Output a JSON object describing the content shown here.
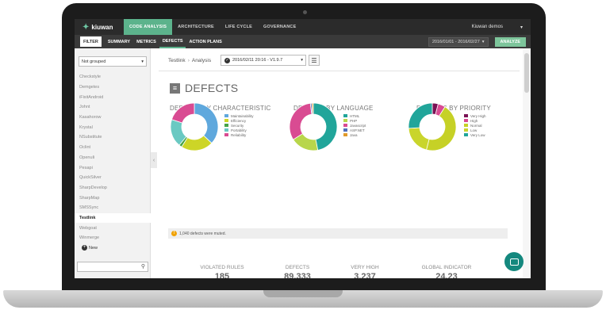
{
  "app": {
    "brand": "kiuwan",
    "nav_tabs": [
      "CODE ANALYSIS",
      "ARCHITECTURE",
      "LIFE CYCLE",
      "GOVERNANCE"
    ],
    "user": "Kiuwan demos"
  },
  "subnav": {
    "filter": "FILTER",
    "tabs": [
      "SUMMARY",
      "METRICS",
      "DEFECTS",
      "ACTION PLANS"
    ],
    "date_range": "2016/01/01 - 2016/02/27",
    "analyze": "ANALYZE"
  },
  "sidebar": {
    "group_select": "Not grouped",
    "projects": [
      "Checkstyle",
      "Demgetes",
      "iFixitAndroid",
      "Johnt",
      "Kasahorow",
      "Krystal",
      "NSubstitute",
      "Oclint",
      "OpenuIi",
      "Pesapi",
      "QuickSilver",
      "SharpDevelop",
      "SharpMap",
      "SMSSync",
      "Testlink",
      "Webgoat",
      "Winmerge"
    ],
    "active_project": "Testlink",
    "new_label": "New"
  },
  "main": {
    "breadcrumb": [
      "Testlink",
      "Analysis"
    ],
    "version": "2016/02/11 20:16 - V1.9.7",
    "title": "DEFECTS",
    "notice": "1,040 defects were muted."
  },
  "charts": {
    "characteristic_title": "DEFECTS BY CHARACTERISTIC",
    "language_title": "DEFECTS BY LANGUAGE",
    "priority_title": "DEFECTS BY PRIORITY"
  },
  "chart_data": [
    {
      "type": "pie",
      "title": "DEFECTS BY CHARACTERISTIC",
      "categories": [
        "Maintainability",
        "Efficiency",
        "Security",
        "Portability",
        "Reliability"
      ],
      "values": [
        37,
        22,
        2,
        19,
        20
      ],
      "colors": [
        "#5fa8dd",
        "#cdd527",
        "#47a447",
        "#6ac9c2",
        "#d94b92"
      ]
    },
    {
      "type": "pie",
      "title": "DEFECTS BY LANGUAGE",
      "categories": [
        "HTML",
        "PHP",
        "Javascript",
        "ASP.NET",
        "Java"
      ],
      "values": [
        47,
        19,
        32,
        1,
        1
      ],
      "colors": [
        "#21a59a",
        "#b8d64b",
        "#d94b92",
        "#4f6fbd",
        "#e09a2b"
      ]
    },
    {
      "type": "pie",
      "title": "DEFECTS BY PRIORITY",
      "categories": [
        "Very High",
        "High",
        "Normal",
        "Low",
        "Very Low"
      ],
      "values": [
        4,
        5,
        45,
        20,
        26
      ],
      "colors": [
        "#7a1254",
        "#d94b92",
        "#c6d126",
        "#c9d52c",
        "#21a59a"
      ]
    }
  ],
  "stats": [
    {
      "label": "VIOLATED RULES",
      "value": "185"
    },
    {
      "label": "DEFECTS",
      "value": "89.333"
    },
    {
      "label": "VERY HIGH",
      "value": "3.237"
    },
    {
      "label": "GLOBAL INDICATOR",
      "value": "24.23"
    }
  ]
}
